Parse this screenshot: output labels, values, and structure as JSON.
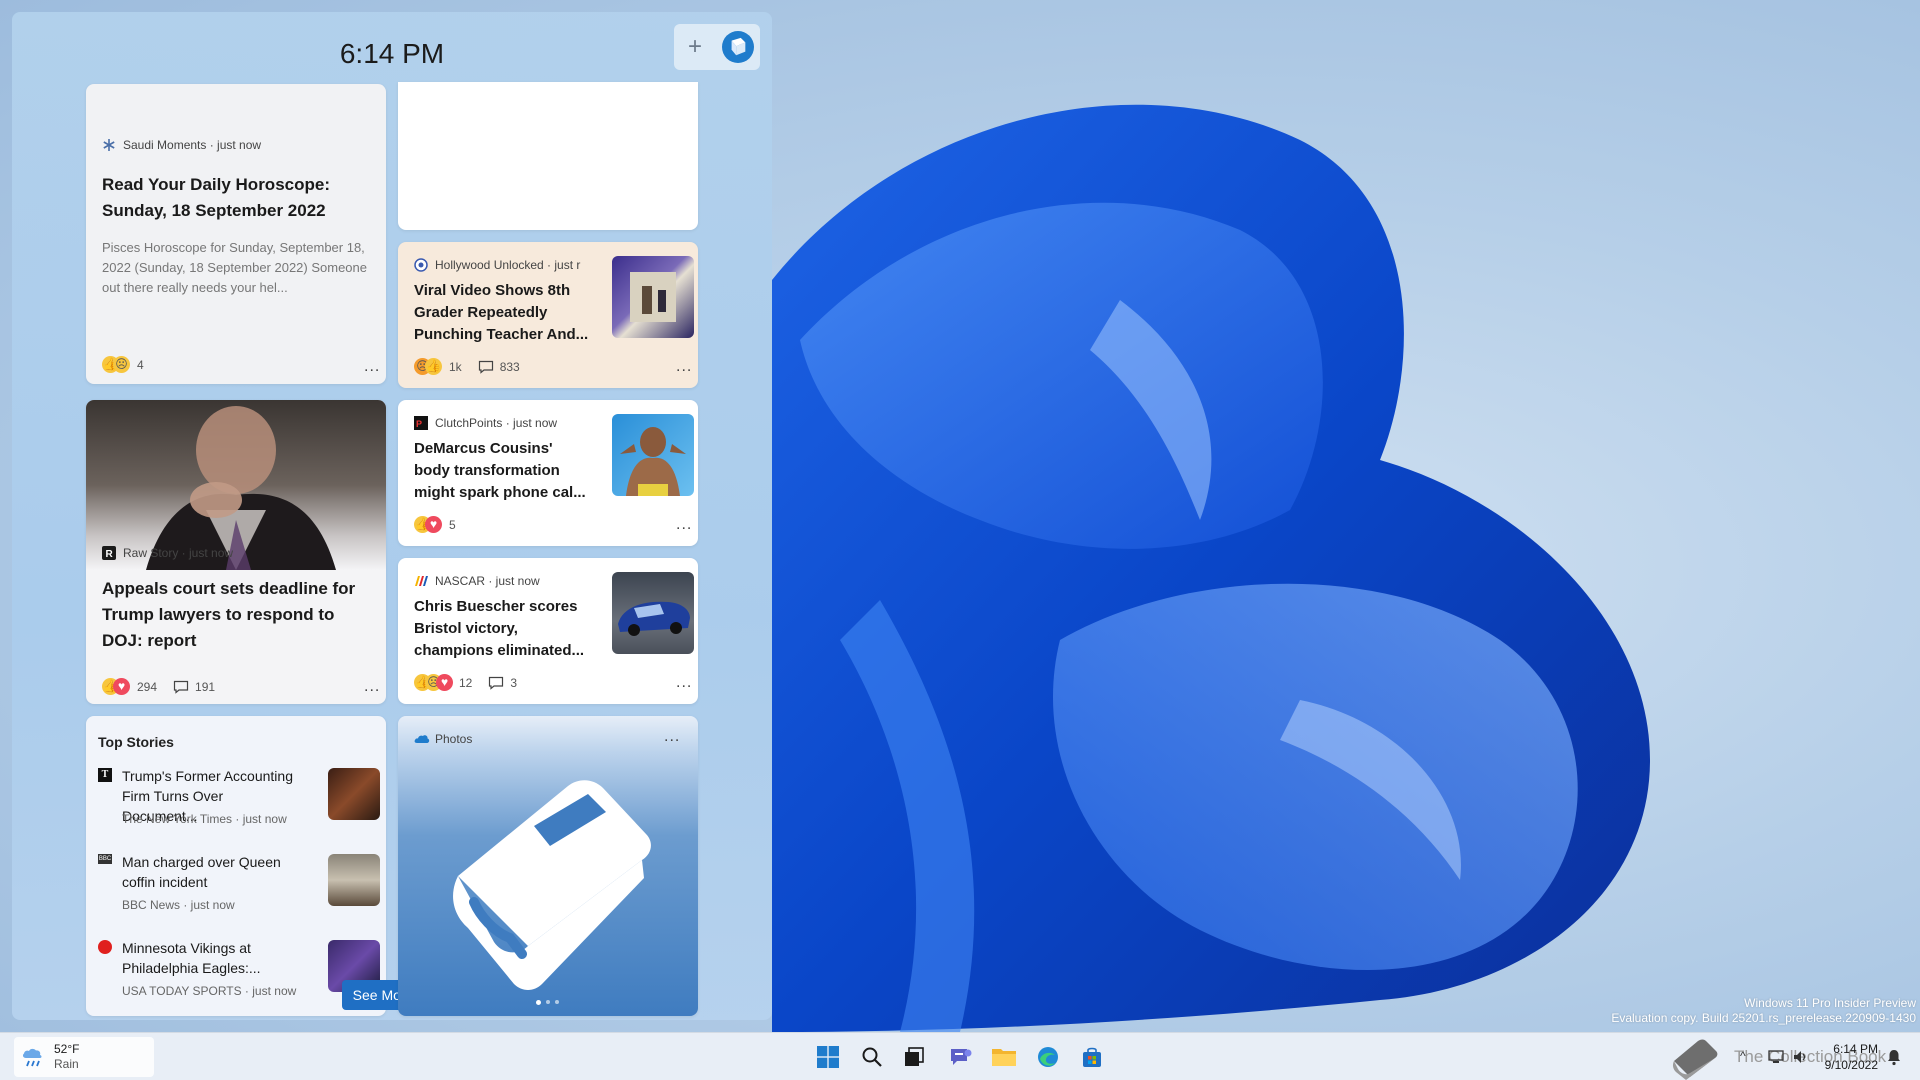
{
  "board": {
    "time": "6:14 PM",
    "add_label": "+"
  },
  "cards": {
    "horoscope": {
      "source": "Saudi Moments · just now",
      "title": "Read Your Daily Horoscope: Sunday, 18 September 2022",
      "snippet": "Pisces Horoscope for Sunday, September 18, 2022 (Sunday, 18 September 2022) Someone out there really needs your hel...",
      "reactions": "4",
      "more": "..."
    },
    "viral": {
      "source": "Hollywood Unlocked · just r",
      "title": "Viral Video Shows 8th Grader Repeatedly Punching Teacher And...",
      "reactions": "1k",
      "comments": "833",
      "more": "..."
    },
    "court": {
      "source": "Raw Story · just now",
      "title": "Appeals court sets deadline for Trump lawyers to respond to DOJ: report",
      "reactions": "294",
      "comments": "191",
      "more": "..."
    },
    "demarcus": {
      "source": "ClutchPoints · just now",
      "title": "DeMarcus Cousins' body transformation might spark phone cal...",
      "reactions": "5",
      "more": "..."
    },
    "nascar": {
      "source": "NASCAR · just now",
      "title": "Chris Buescher scores Bristol victory, champions eliminated...",
      "reactions": "12",
      "comments": "3",
      "more": "..."
    },
    "top_stories": {
      "heading": "Top Stories",
      "items": [
        {
          "title": "Trump's Former Accounting Firm Turns Over Document...",
          "meta": "The New York Times · just now"
        },
        {
          "title": "Man charged over Queen coffin incident",
          "meta": "BBC News · just now"
        },
        {
          "title": "Minnesota Vikings at Philadelphia Eagles:...",
          "meta": "USA TODAY SPORTS · just now"
        }
      ],
      "see_more": "See More"
    },
    "photos": {
      "title": "Photos",
      "more": "..."
    }
  },
  "watermark": {
    "line1": "Windows 11 Pro Insider Preview",
    "line2": "Evaluation copy. Build 25201.rs_prerelease.220909-1430"
  },
  "taskbar": {
    "weather_temp": "52°F",
    "weather_condition": "Rain",
    "tray_text": "The Collection Book",
    "clock_time": "6:14 PM",
    "clock_date": "9/10/2022"
  }
}
